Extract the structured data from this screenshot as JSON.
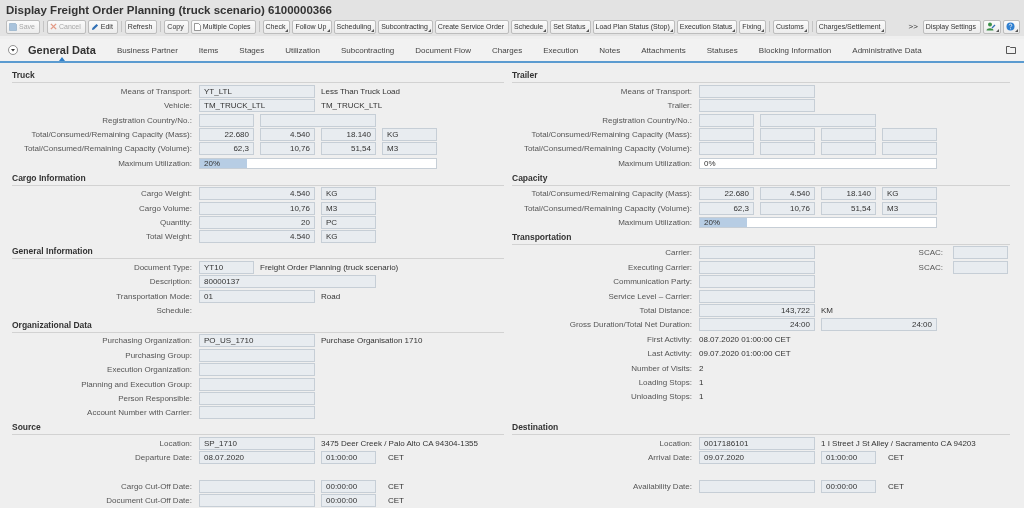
{
  "window": {
    "title": "Display Freight Order Planning (truck scenario) 6100000366"
  },
  "toolbar": {
    "groups": [
      [
        {
          "label": "Save",
          "kind": "save",
          "disabled": true
        }
      ],
      [
        {
          "label": "Cancel",
          "kind": "cancel",
          "disabled": true
        },
        {
          "label": "Edit",
          "kind": "edit",
          "disabled": false
        }
      ],
      [
        {
          "label": "Refresh",
          "kind": "plain",
          "disabled": false
        }
      ],
      [
        {
          "label": "Copy",
          "kind": "plain",
          "disabled": false
        },
        {
          "label": "Multiple Copies",
          "kind": "copy",
          "disabled": false
        }
      ],
      [
        {
          "label": "Check",
          "kind": "menu",
          "disabled": false
        },
        {
          "label": "Follow Up",
          "kind": "menu",
          "disabled": false
        },
        {
          "label": "Scheduling",
          "kind": "menu",
          "disabled": false
        },
        {
          "label": "Subcontracting",
          "kind": "menu",
          "disabled": false
        },
        {
          "label": "Create Service Order",
          "kind": "plain",
          "disabled": false
        },
        {
          "label": "Schedule",
          "kind": "menu",
          "disabled": false
        },
        {
          "label": "Set Status",
          "kind": "menu",
          "disabled": false
        },
        {
          "label": "Load Plan Status (Stop)",
          "kind": "menu",
          "disabled": false
        },
        {
          "label": "Execution Status",
          "kind": "menu",
          "disabled": false
        },
        {
          "label": "Fixing",
          "kind": "menu",
          "disabled": false
        }
      ],
      [
        {
          "label": "Customs",
          "kind": "menu",
          "disabled": false
        }
      ],
      [
        {
          "label": "Charges/Settlement",
          "kind": "menu",
          "disabled": false
        }
      ]
    ],
    "overflow": ">>",
    "right": [
      {
        "label": "Display Settings",
        "kind": "plain",
        "disabled": false
      },
      {
        "kind": "user"
      },
      {
        "kind": "help"
      }
    ]
  },
  "tabs": [
    {
      "label": "General Data",
      "selected": true
    },
    {
      "label": "Business Partner",
      "selected": false
    },
    {
      "label": "Items",
      "selected": false
    },
    {
      "label": "Stages",
      "selected": false
    },
    {
      "label": "Utilization",
      "selected": false
    },
    {
      "label": "Subcontracting",
      "selected": false
    },
    {
      "label": "Document Flow",
      "selected": false
    },
    {
      "label": "Charges",
      "selected": false
    },
    {
      "label": "Execution",
      "selected": false
    },
    {
      "label": "Notes",
      "selected": false
    },
    {
      "label": "Attachments",
      "selected": false
    },
    {
      "label": "Statuses",
      "selected": false
    },
    {
      "label": "Blocking Information",
      "selected": false
    },
    {
      "label": "Administrative Data",
      "selected": false
    }
  ],
  "upper": {
    "left": [
      {
        "title": "Truck",
        "rows": [
          {
            "kind": "fields",
            "label": "Means of Transport:",
            "cells": [
              {
                "kind": "field",
                "value": "YT_LTL"
              },
              {
                "kind": "text",
                "value": "Less Than Truck Load"
              }
            ]
          },
          {
            "kind": "fields",
            "label": "Vehicle:",
            "cells": [
              {
                "kind": "field",
                "value": "TM_TRUCK_LTL"
              },
              {
                "kind": "text",
                "value": "TM_TRUCK_LTL"
              }
            ]
          },
          {
            "kind": "fields",
            "label": "Registration Country/No.:",
            "cells": [
              {
                "kind": "short"
              },
              {
                "kind": "field"
              }
            ]
          },
          {
            "kind": "fields",
            "label": "Total/Consumed/Remaining Capacity (Mass):",
            "cells": [
              {
                "kind": "number",
                "value": "22.680"
              },
              {
                "kind": "number",
                "value": "4.540"
              },
              {
                "kind": "number",
                "value": "18.140"
              },
              {
                "kind": "short",
                "value": "KG"
              }
            ]
          },
          {
            "kind": "fields",
            "label": "Total/Consumed/Remaining Capacity (Volume):",
            "cells": [
              {
                "kind": "number",
                "value": "62,3"
              },
              {
                "kind": "number",
                "value": "10,76"
              },
              {
                "kind": "number",
                "value": "51,54"
              },
              {
                "kind": "short",
                "value": "M3"
              }
            ]
          },
          {
            "kind": "fields",
            "label": "Maximum Utilization:",
            "cells": [
              {
                "kind": "bar",
                "level": 0.2,
                "value": "20%"
              }
            ]
          }
        ]
      },
      {
        "title": "Cargo Information",
        "rows": [
          {
            "kind": "fields",
            "label": "Cargo Weight:",
            "cells": [
              {
                "kind": "longnumber",
                "value": "4.540"
              },
              {
                "kind": "short",
                "value": "KG"
              }
            ]
          },
          {
            "kind": "fields",
            "label": "Cargo Volume:",
            "cells": [
              {
                "kind": "longnumber",
                "value": "10,76"
              },
              {
                "kind": "short",
                "value": "M3"
              }
            ]
          },
          {
            "kind": "fields",
            "label": "Quantity:",
            "cells": [
              {
                "kind": "longnumber",
                "value": "20"
              },
              {
                "kind": "short",
                "value": "PC"
              }
            ]
          },
          {
            "kind": "fields",
            "label": "Total Weight:",
            "cells": [
              {
                "kind": "longnumber",
                "value": "4.540"
              },
              {
                "kind": "short",
                "value": "KG"
              }
            ]
          }
        ]
      },
      {
        "title": "General Information",
        "rows": [
          {
            "kind": "fields",
            "label": "Document Type:",
            "cells": [
              {
                "kind": "short",
                "value": "YT10"
              },
              {
                "kind": "text",
                "value": "Freight Order Planning (truck scenario)"
              }
            ]
          },
          {
            "kind": "fields",
            "label": "Description:",
            "cells": [
              {
                "kind": "longfield",
                "value": "80000137"
              }
            ]
          },
          {
            "kind": "fields",
            "label": "Transportation Mode:",
            "cells": [
              {
                "kind": "field",
                "value": "01"
              },
              {
                "kind": "text",
                "value": "Road"
              }
            ]
          },
          {
            "kind": "fields",
            "label": "Schedule:",
            "cells": []
          }
        ]
      },
      {
        "title": "Organizational Data",
        "rows": [
          {
            "kind": "fields",
            "label": "Purchasing Organization:",
            "cells": [
              {
                "kind": "field",
                "value": "PO_US_1710"
              },
              {
                "kind": "text",
                "value": "Purchase Organisation 1710"
              }
            ]
          },
          {
            "kind": "fields",
            "label": "Purchasing Group:",
            "cells": [
              {
                "kind": "field"
              }
            ]
          },
          {
            "kind": "fields",
            "label": "Execution Organization:",
            "cells": [
              {
                "kind": "field"
              }
            ]
          },
          {
            "kind": "fields",
            "label": "Planning and Execution Group:",
            "cells": [
              {
                "kind": "field"
              }
            ]
          },
          {
            "kind": "fields",
            "label": "Person Responsible:",
            "cells": [
              {
                "kind": "field"
              }
            ]
          },
          {
            "kind": "fields",
            "label": "Account Number with Carrier:",
            "cells": [
              {
                "kind": "field"
              }
            ]
          }
        ]
      }
    ],
    "right": [
      {
        "title": "Trailer",
        "rows": [
          {
            "kind": "fields",
            "label": "Means of Transport:",
            "cells": [
              {
                "kind": "field"
              }
            ]
          },
          {
            "kind": "fields",
            "label": "Trailer:",
            "cells": [
              {
                "kind": "field"
              }
            ]
          },
          {
            "kind": "fields",
            "label": "Registration Country/No.:",
            "cells": [
              {
                "kind": "short"
              },
              {
                "kind": "field"
              }
            ]
          },
          {
            "kind": "fields",
            "label": "Total/Consumed/Remaining Capacity (Mass):",
            "cells": [
              {
                "kind": "short"
              },
              {
                "kind": "short"
              },
              {
                "kind": "short"
              },
              {
                "kind": "short"
              }
            ]
          },
          {
            "kind": "fields",
            "label": "Total/Consumed/Remaining Capacity (Volume):",
            "cells": [
              {
                "kind": "short"
              },
              {
                "kind": "short"
              },
              {
                "kind": "short"
              },
              {
                "kind": "short"
              }
            ]
          },
          {
            "kind": "fields",
            "label": "Maximum Utilization:",
            "cells": [
              {
                "kind": "bar",
                "level": 0,
                "value": "0%"
              }
            ]
          }
        ]
      },
      {
        "title": "Capacity",
        "rows": [
          {
            "kind": "fields",
            "label": "Total/Consumed/Remaining Capacity (Mass):",
            "cells": [
              {
                "kind": "number",
                "value": "22.680"
              },
              {
                "kind": "number",
                "value": "4.540"
              },
              {
                "kind": "number",
                "value": "18.140"
              },
              {
                "kind": "short",
                "value": "KG"
              }
            ]
          },
          {
            "kind": "fields",
            "label": "Total/Consumed/Remaining Capacity (Volume):",
            "cells": [
              {
                "kind": "number",
                "value": "62,3"
              },
              {
                "kind": "number",
                "value": "10,76"
              },
              {
                "kind": "number",
                "value": "51,54"
              },
              {
                "kind": "short",
                "value": "M3"
              }
            ]
          },
          {
            "kind": "fields",
            "label": "Maximum Utilization:",
            "cells": [
              {
                "kind": "bar",
                "level": 0.2,
                "value": "20%"
              }
            ]
          }
        ]
      },
      {
        "title": "Transportation",
        "rows": [
          {
            "kind": "fields",
            "label": "Carrier:",
            "cells": [
              {
                "kind": "field"
              },
              {
                "kind": "sublabel",
                "value": "SCAC:"
              },
              {
                "kind": "short"
              }
            ]
          },
          {
            "kind": "fields",
            "label": "Executing Carrier:",
            "cells": [
              {
                "kind": "field"
              },
              {
                "kind": "sublabel",
                "value": "SCAC:"
              },
              {
                "kind": "short"
              }
            ]
          },
          {
            "kind": "fields",
            "label": "Communication Party:",
            "cells": [
              {
                "kind": "field"
              }
            ]
          },
          {
            "kind": "fields",
            "label": "Service Level – Carrier:",
            "cells": [
              {
                "kind": "field"
              }
            ]
          },
          {
            "kind": "fields",
            "label": "Total Distance:",
            "cells": [
              {
                "kind": "longnumber",
                "value": "143,722"
              },
              {
                "kind": "text",
                "value": "KM"
              }
            ]
          },
          {
            "kind": "fields",
            "label": "Gross Duration/Total Net Duration:",
            "cells": [
              {
                "kind": "longnumber",
                "value": "24:00"
              },
              {
                "kind": "longnumber",
                "value": "24:00"
              }
            ]
          },
          {
            "kind": "fields",
            "label": "First Activity:",
            "cells": [
              {
                "kind": "text",
                "value": "08.07.2020 01:00:00 CET"
              }
            ]
          },
          {
            "kind": "fields",
            "label": "Last Activity:",
            "cells": [
              {
                "kind": "text",
                "value": "09.07.2020 01:00:00 CET"
              }
            ]
          },
          {
            "kind": "fields",
            "label": "Number of Visits:",
            "cells": [
              {
                "kind": "text",
                "value": "2"
              }
            ]
          },
          {
            "kind": "fields",
            "label": "Loading Stops:",
            "cells": [
              {
                "kind": "text",
                "value": "1"
              }
            ]
          },
          {
            "kind": "fields",
            "label": "Unloading Stops:",
            "cells": [
              {
                "kind": "text",
                "value": "1"
              }
            ]
          }
        ]
      }
    ]
  },
  "lower": {
    "left": [
      {
        "title": "Source",
        "rows": [
          {
            "kind": "fields",
            "label": "Location:",
            "cells": [
              {
                "kind": "field",
                "value": "SP_1710"
              },
              {
                "kind": "text",
                "value": "3475 Deer Creek / Palo Alto CA 94304-1355"
              }
            ]
          },
          {
            "kind": "fields",
            "label": "Departure Date:",
            "cells": [
              {
                "kind": "field",
                "value": "08.07.2020"
              },
              {
                "kind": "short",
                "value": "01:00:00"
              },
              {
                "kind": "unit",
                "value": "CET"
              }
            ]
          },
          {
            "kind": "spacer"
          },
          {
            "kind": "fields",
            "label": "Cargo Cut-Off Date:",
            "cells": [
              {
                "kind": "field"
              },
              {
                "kind": "short",
                "value": "00:00:00"
              },
              {
                "kind": "unit",
                "value": "CET"
              }
            ]
          },
          {
            "kind": "fields",
            "label": "Document Cut-Off Date:",
            "cells": [
              {
                "kind": "field"
              },
              {
                "kind": "short",
                "value": "00:00:00"
              },
              {
                "kind": "unit",
                "value": "CET"
              }
            ]
          }
        ]
      }
    ],
    "right": [
      {
        "title": "Destination",
        "rows": [
          {
            "kind": "fields",
            "label": "Location:",
            "cells": [
              {
                "kind": "field",
                "value": "0017186101"
              },
              {
                "kind": "text",
                "value": "1 I Street J St Alley / Sacramento CA 94203"
              }
            ]
          },
          {
            "kind": "fields",
            "label": "Arrival Date:",
            "cells": [
              {
                "kind": "field",
                "value": "09.07.2020"
              },
              {
                "kind": "short",
                "value": "01:00:00"
              },
              {
                "kind": "unit",
                "value": "CET"
              }
            ]
          },
          {
            "kind": "spacer"
          },
          {
            "kind": "fields",
            "label": "Availability Date:",
            "cells": [
              {
                "kind": "field"
              },
              {
                "kind": "short",
                "value": "00:00:00"
              },
              {
                "kind": "unit",
                "value": "CET"
              }
            ]
          }
        ]
      }
    ]
  }
}
